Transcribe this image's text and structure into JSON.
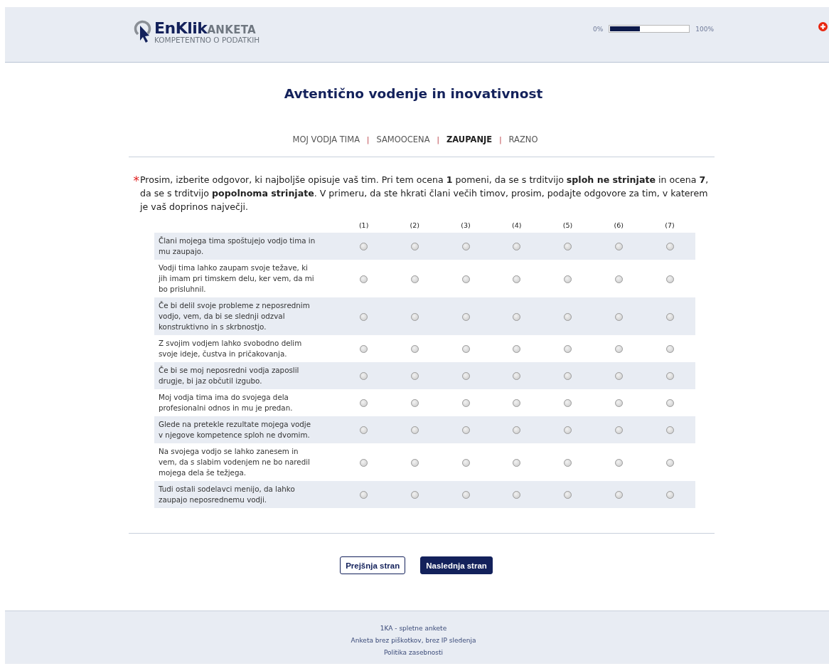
{
  "header": {
    "logo": {
      "brand": "EnKlik",
      "suffix": "ANKETA",
      "tagline": "KOMPETENTNO O PODATKIH"
    },
    "progress": {
      "start_label": "0%",
      "level": 0.38,
      "end_label": "100%"
    }
  },
  "title": "Avtentično vodenje in inovativnost",
  "nav": [
    {
      "label": "MOJ VODJA TIMA",
      "selected": false
    },
    {
      "label": "SAMOOCENA",
      "selected": false
    },
    {
      "label": "ZAUPANJE",
      "selected": true
    },
    {
      "label": "RAZNO",
      "selected": false
    }
  ],
  "nav_separator": "|",
  "question": {
    "required": true,
    "required_mark": "*",
    "text": "Prosim, izberite odgovor, ki najboljše opisuje vaš tim. Pri tem ocena **1** pomeni, da se s trditvijo **sploh ne strinjate** in ocena **7**, da se s trditvijo **popolnoma strinjate**. V primeru, da ste hkrati člani večih timov, prosim, podajte odgovore za tim, v katerem je vaš doprinos največji."
  },
  "scale": [
    "(1)",
    "(2)",
    "(3)",
    "(4)",
    "(5)",
    "(6)",
    "(7)"
  ],
  "rows": [
    {
      "statement": "Člani mojega tima spoštujejo vodjo tima in mu zaupajo.",
      "options": [
        {
          "selected": false
        },
        {
          "selected": false
        },
        {
          "selected": false
        },
        {
          "selected": false
        },
        {
          "selected": false
        },
        {
          "selected": false
        },
        {
          "selected": false
        }
      ]
    },
    {
      "statement": "Vodji tima lahko zaupam svoje težave, ki jih imam pri timskem delu, ker vem, da mi bo prisluhnil.",
      "options": [
        {
          "selected": false
        },
        {
          "selected": false
        },
        {
          "selected": false
        },
        {
          "selected": false
        },
        {
          "selected": false
        },
        {
          "selected": false
        },
        {
          "selected": false
        }
      ]
    },
    {
      "statement": "Če bi delil svoje probleme z neposrednim vodjo, vem, da bi se slednji odzval konstruktivno in s skrbnostjo.",
      "options": [
        {
          "selected": false
        },
        {
          "selected": false
        },
        {
          "selected": false
        },
        {
          "selected": false
        },
        {
          "selected": false
        },
        {
          "selected": false
        },
        {
          "selected": false
        }
      ]
    },
    {
      "statement": "Z svojim vodjem lahko svobodno delim svoje ideje, čustva in  pričakovanja.",
      "options": [
        {
          "selected": false
        },
        {
          "selected": false
        },
        {
          "selected": false
        },
        {
          "selected": false
        },
        {
          "selected": false
        },
        {
          "selected": false
        },
        {
          "selected": false
        }
      ]
    },
    {
      "statement": "Če bi se moj neposredni vodja zaposlil drugje, bi jaz občutil izgubo.",
      "options": [
        {
          "selected": false
        },
        {
          "selected": false
        },
        {
          "selected": false
        },
        {
          "selected": false
        },
        {
          "selected": false
        },
        {
          "selected": false
        },
        {
          "selected": false
        }
      ]
    },
    {
      "statement": "Moj vodja tima ima do svojega dela profesionalni odnos in mu je predan.",
      "options": [
        {
          "selected": false
        },
        {
          "selected": false
        },
        {
          "selected": false
        },
        {
          "selected": false
        },
        {
          "selected": false
        },
        {
          "selected": false
        },
        {
          "selected": false
        }
      ]
    },
    {
      "statement": "Glede na pretekle rezultate mojega vodje v njegove kompetence sploh ne dvomim.",
      "options": [
        {
          "selected": false
        },
        {
          "selected": false
        },
        {
          "selected": false
        },
        {
          "selected": false
        },
        {
          "selected": false
        },
        {
          "selected": false
        },
        {
          "selected": false
        }
      ]
    },
    {
      "statement": "Na svojega vodjo se lahko zanesem in vem, da s slabim vodenjem ne bo naredil mojega dela še težjega.",
      "options": [
        {
          "selected": false
        },
        {
          "selected": false
        },
        {
          "selected": false
        },
        {
          "selected": false
        },
        {
          "selected": false
        },
        {
          "selected": false
        },
        {
          "selected": false
        }
      ]
    },
    {
      "statement": "Tudi ostali sodelavci menijo, da lahko zaupajo neposrednemu vodji.",
      "options": [
        {
          "selected": false
        },
        {
          "selected": false
        },
        {
          "selected": false
        },
        {
          "selected": false
        },
        {
          "selected": false
        },
        {
          "selected": false
        },
        {
          "selected": false
        }
      ]
    }
  ],
  "buttons": [
    {
      "label": "Prejšnja stran",
      "kind": "secondary"
    },
    {
      "label": "Naslednja stran",
      "kind": "primary"
    }
  ],
  "footer": [
    "1KA - spletne ankete",
    "Anketa brez piškotkov, brez IP sledenja",
    "Politika zasebnosti"
  ]
}
